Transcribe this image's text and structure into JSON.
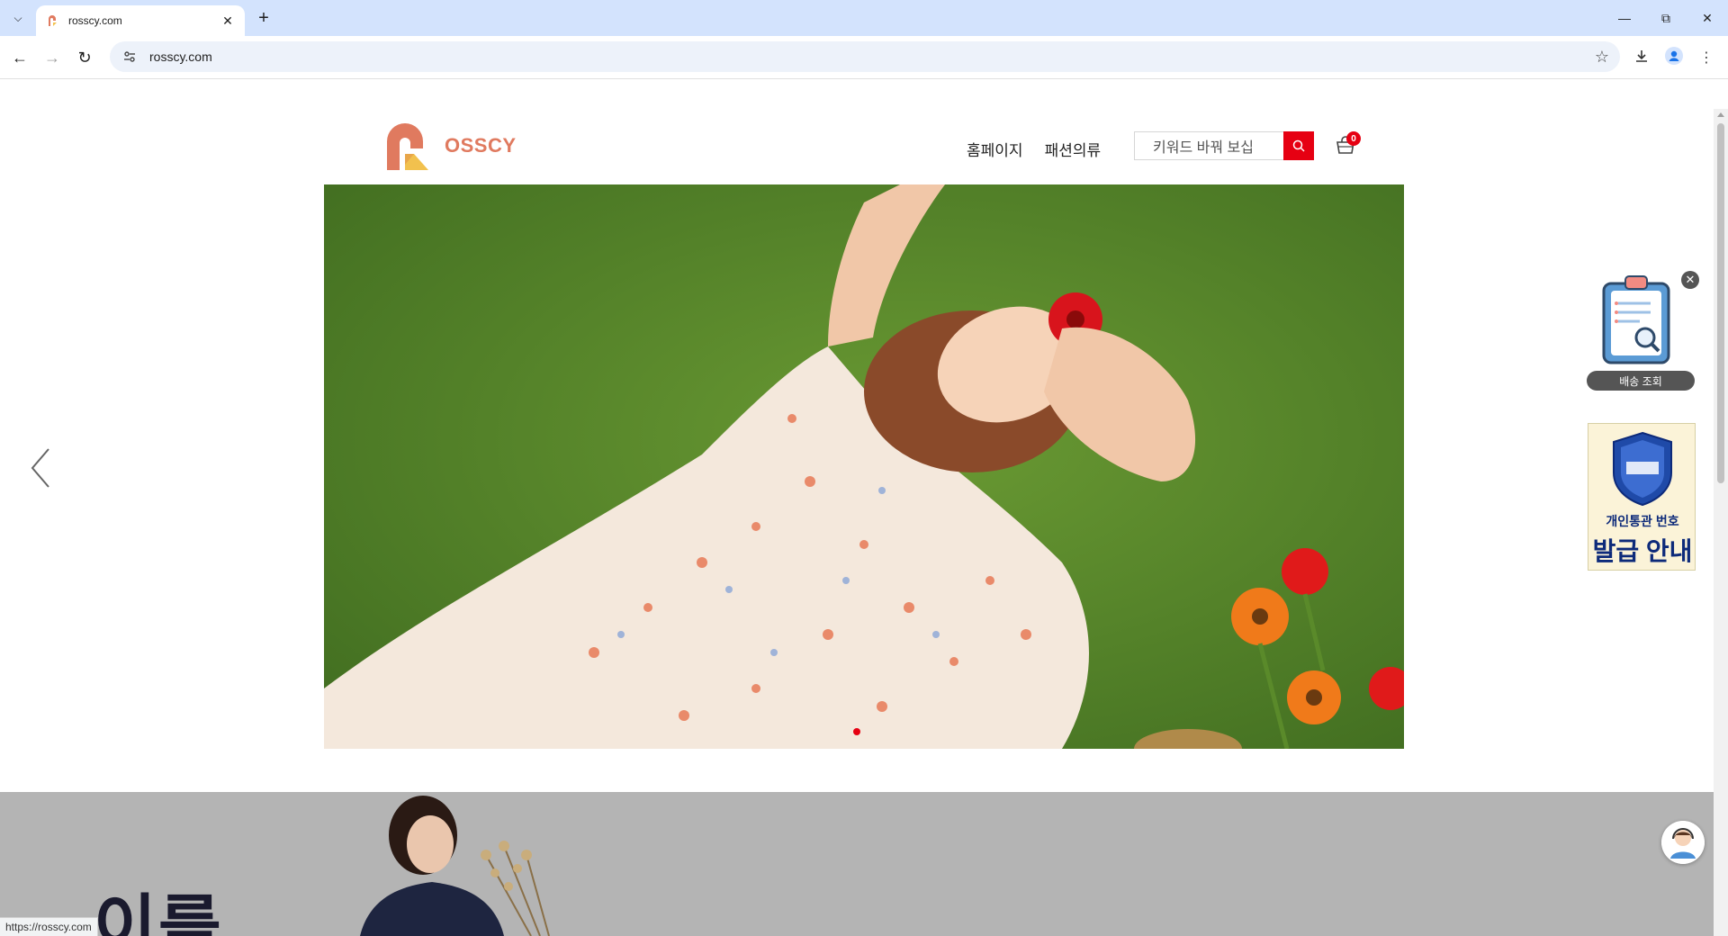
{
  "browser": {
    "tab": {
      "title": "rosscy.com",
      "favicon": "rosscy-favicon-icon"
    },
    "url": "rosscy.com",
    "status_url": "https://rosscy.com",
    "icons": {
      "tab_search": "chevron-down-icon",
      "new_tab": "plus-icon",
      "back": "arrow-left-icon",
      "forward": "arrow-right-icon",
      "reload": "reload-icon",
      "site_info": "site-info-icon",
      "bookmark": "star-icon",
      "download": "download-icon",
      "profile": "profile-icon",
      "menu": "kebab-menu-icon",
      "minimize": "minimize-icon",
      "restore": "restore-icon",
      "close": "close-icon"
    }
  },
  "site": {
    "logo_text": "OSSCY",
    "nav": [
      {
        "label": "홈페이지"
      },
      {
        "label": "패션의류"
      }
    ],
    "search": {
      "placeholder": "키워드 바꿔 보십"
    },
    "cart_count": "0",
    "brand_colors": {
      "logo": "#e07a5f",
      "accent": "#e60012"
    }
  },
  "hero": {
    "current_slide": 1,
    "icon": "carousel-prev-icon"
  },
  "promo": {
    "headline": "이를"
  },
  "widgets": {
    "delivery_label": "배송 조회",
    "customs": {
      "line1": "개인통관 번호",
      "line2": "발급 안내"
    }
  }
}
